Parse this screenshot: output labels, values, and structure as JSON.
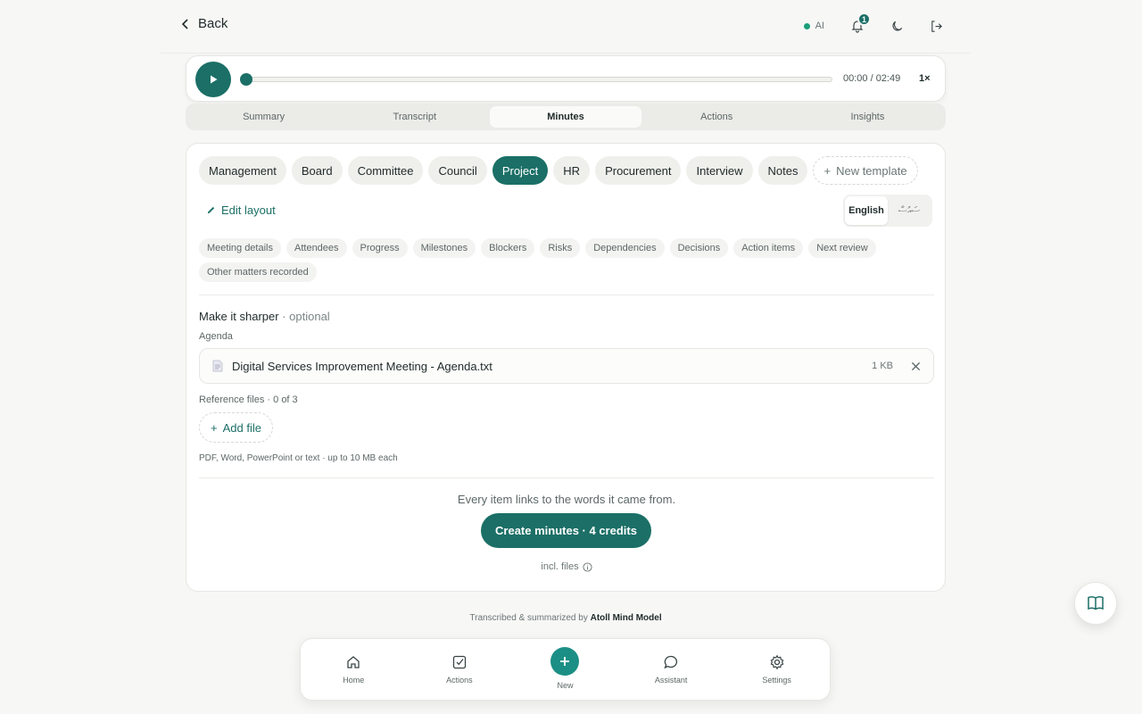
{
  "topbar": {
    "back_label": "Back",
    "ai_label": "AI",
    "notification_count": "1"
  },
  "player": {
    "time": "00:00 / 02:49",
    "speed": "1×",
    "progress": 0
  },
  "tabs": [
    {
      "label": "Summary"
    },
    {
      "label": "Transcript"
    },
    {
      "label": "Minutes"
    },
    {
      "label": "Actions"
    },
    {
      "label": "Insights"
    }
  ],
  "templates": {
    "items": [
      "Management",
      "Board",
      "Committee",
      "Council",
      "Project",
      "HR",
      "Procurement",
      "Interview",
      "Notes"
    ],
    "active": "Project",
    "new_label": "New template"
  },
  "edit_layout_label": "Edit layout",
  "language": {
    "options": [
      "English",
      "ސައުސް"
    ],
    "active": "English"
  },
  "sections": [
    "Meeting details",
    "Attendees",
    "Progress",
    "Milestones",
    "Blockers",
    "Risks",
    "Dependencies",
    "Decisions",
    "Action items",
    "Next review",
    "Other matters recorded"
  ],
  "sharper": {
    "title": "Make it sharper",
    "optional": " · optional"
  },
  "agenda": {
    "label": "Agenda",
    "file_name": "Digital Services Improvement Meeting - Agenda.txt",
    "file_size": "1 KB"
  },
  "reference": {
    "label": "Reference files · 0 of 3",
    "add_label": "Add file",
    "hint": "PDF, Word, PowerPoint or text · up to 10 MB each"
  },
  "create": {
    "note": "Every item links to the words it came from.",
    "button": "Create minutes · 4 credits",
    "incl": "incl. files"
  },
  "footer": {
    "prefix": "Transcribed & summarized by ",
    "model": "Atoll Mind Model"
  },
  "bottom_nav": [
    {
      "label": "Home",
      "icon": "home-icon"
    },
    {
      "label": "Actions",
      "icon": "checkbox-icon"
    },
    {
      "label": "New",
      "icon": "plus-icon"
    },
    {
      "label": "Assistant",
      "icon": "chat-icon"
    },
    {
      "label": "Settings",
      "icon": "gear-icon"
    }
  ],
  "colors": {
    "accent": "#1b6f66",
    "background": "#f7f7f6"
  }
}
